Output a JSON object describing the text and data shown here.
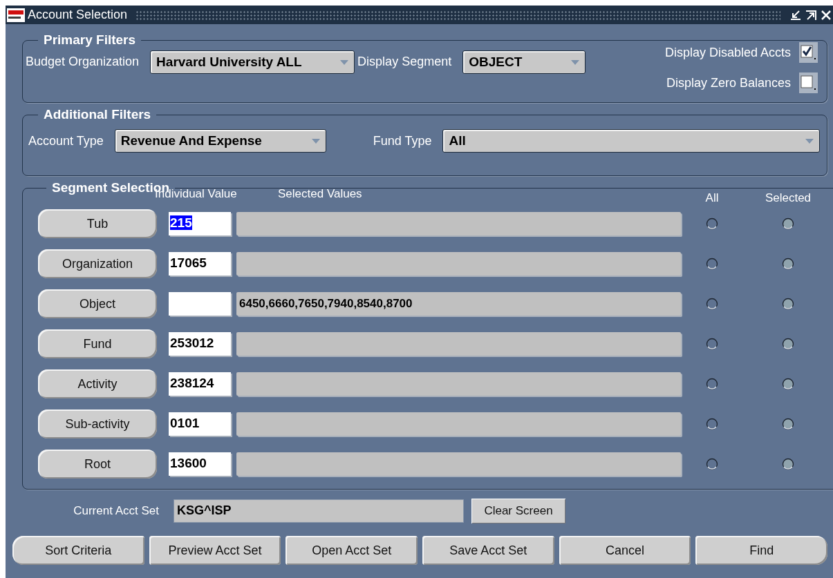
{
  "window": {
    "title": "Account Selection"
  },
  "primary_filters": {
    "title": "Primary Filters",
    "budget_organization": {
      "label": "Budget Organization",
      "value": "Harvard University ALL"
    },
    "display_segment": {
      "label": "Display Segment",
      "value": "OBJECT"
    },
    "checkboxes": [
      {
        "label": "Display Disabled Accts",
        "checked": true
      },
      {
        "label": "Display Zero Balances",
        "checked": false
      }
    ]
  },
  "additional_filters": {
    "title": "Additional Filters",
    "account_type": {
      "label": "Account Type",
      "value": "Revenue And Expense"
    },
    "fund_type": {
      "label": "Fund Type",
      "value": "All"
    }
  },
  "segment_selection": {
    "title": "Segment Selection",
    "columns": [
      "Individual Value",
      "Selected Values",
      "All",
      "Selected"
    ],
    "rows": [
      {
        "segment": "Tub",
        "individual_value": "215",
        "value_highlighted": true,
        "radios": [
          {
            "selected": false
          },
          {
            "selected": true
          }
        ]
      },
      {
        "segment": "Organization",
        "individual_value": "17065",
        "radios": [
          {
            "selected": false
          },
          {
            "selected": true
          }
        ]
      },
      {
        "segment": "Object",
        "selected_values": "6450,6660,7650,7940,8540,8700",
        "radios": [
          {
            "selected": false
          },
          {
            "selected": true
          }
        ]
      },
      {
        "segment": "Fund",
        "individual_value": "253012",
        "radios": [
          {
            "selected": false
          },
          {
            "selected": true
          }
        ]
      },
      {
        "segment": "Activity",
        "individual_value": "238124",
        "radios": [
          {
            "selected": false
          },
          {
            "selected": true
          }
        ]
      },
      {
        "segment": "Sub-activity",
        "individual_value": "0101",
        "radios": [
          {
            "selected": false
          },
          {
            "selected": true
          }
        ]
      },
      {
        "segment": "Root",
        "individual_value": "13600",
        "radios": [
          {
            "selected": false
          },
          {
            "selected": true
          }
        ]
      }
    ]
  },
  "current_acct_set": {
    "label": "Current Acct Set",
    "value": "KSG^ISP",
    "clear_button": "Clear Screen"
  },
  "buttons": [
    "Sort Criteria",
    "Preview Acct Set",
    "Open Acct Set",
    "Save Acct Set",
    "Cancel",
    "Find"
  ]
}
